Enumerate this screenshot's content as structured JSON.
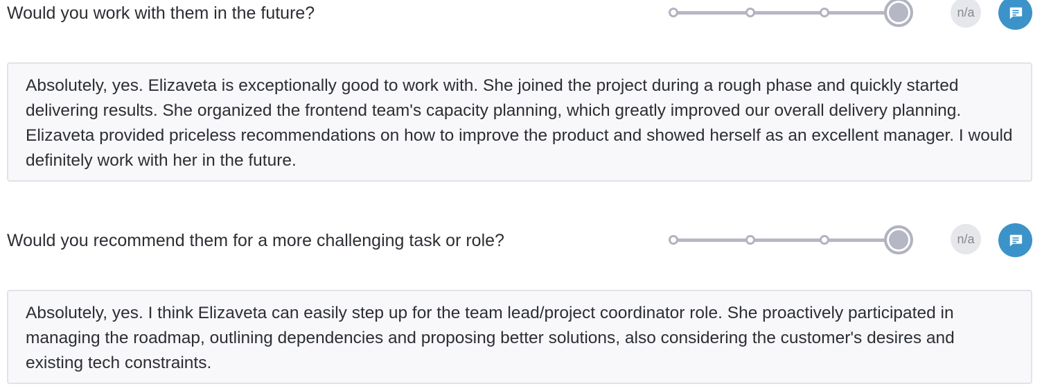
{
  "colors": {
    "accent": "#3c93c9",
    "scale_track": "#b7b8c4",
    "na_bg": "#e6e7ea",
    "answer_bg": "#f8f8fb"
  },
  "questions": [
    {
      "text": "Would you work with them in the future?",
      "scale": {
        "points": 4,
        "selected": 4
      },
      "na_label": "n/a",
      "comment_icon": "comment-icon",
      "answer": "Absolutely, yes. Elizaveta is exceptionally good to work with. She joined the project during a rough phase and quickly started delivering results. She organized the frontend team's capacity planning, which greatly improved our overall delivery planning. Elizaveta provided priceless recommendations on how to improve the product and showed herself as an excellent manager. I would definitely work with her in the future."
    },
    {
      "text": "Would you recommend them for a more challenging task or role?",
      "scale": {
        "points": 4,
        "selected": 4
      },
      "na_label": "n/a",
      "comment_icon": "comment-icon",
      "answer": "Absolutely, yes. I think Elizaveta can easily step up for the team lead/project coordinator role. She proactively participated in managing the roadmap, outlining dependencies and proposing better solutions, also considering the customer's desires and existing tech constraints."
    }
  ]
}
